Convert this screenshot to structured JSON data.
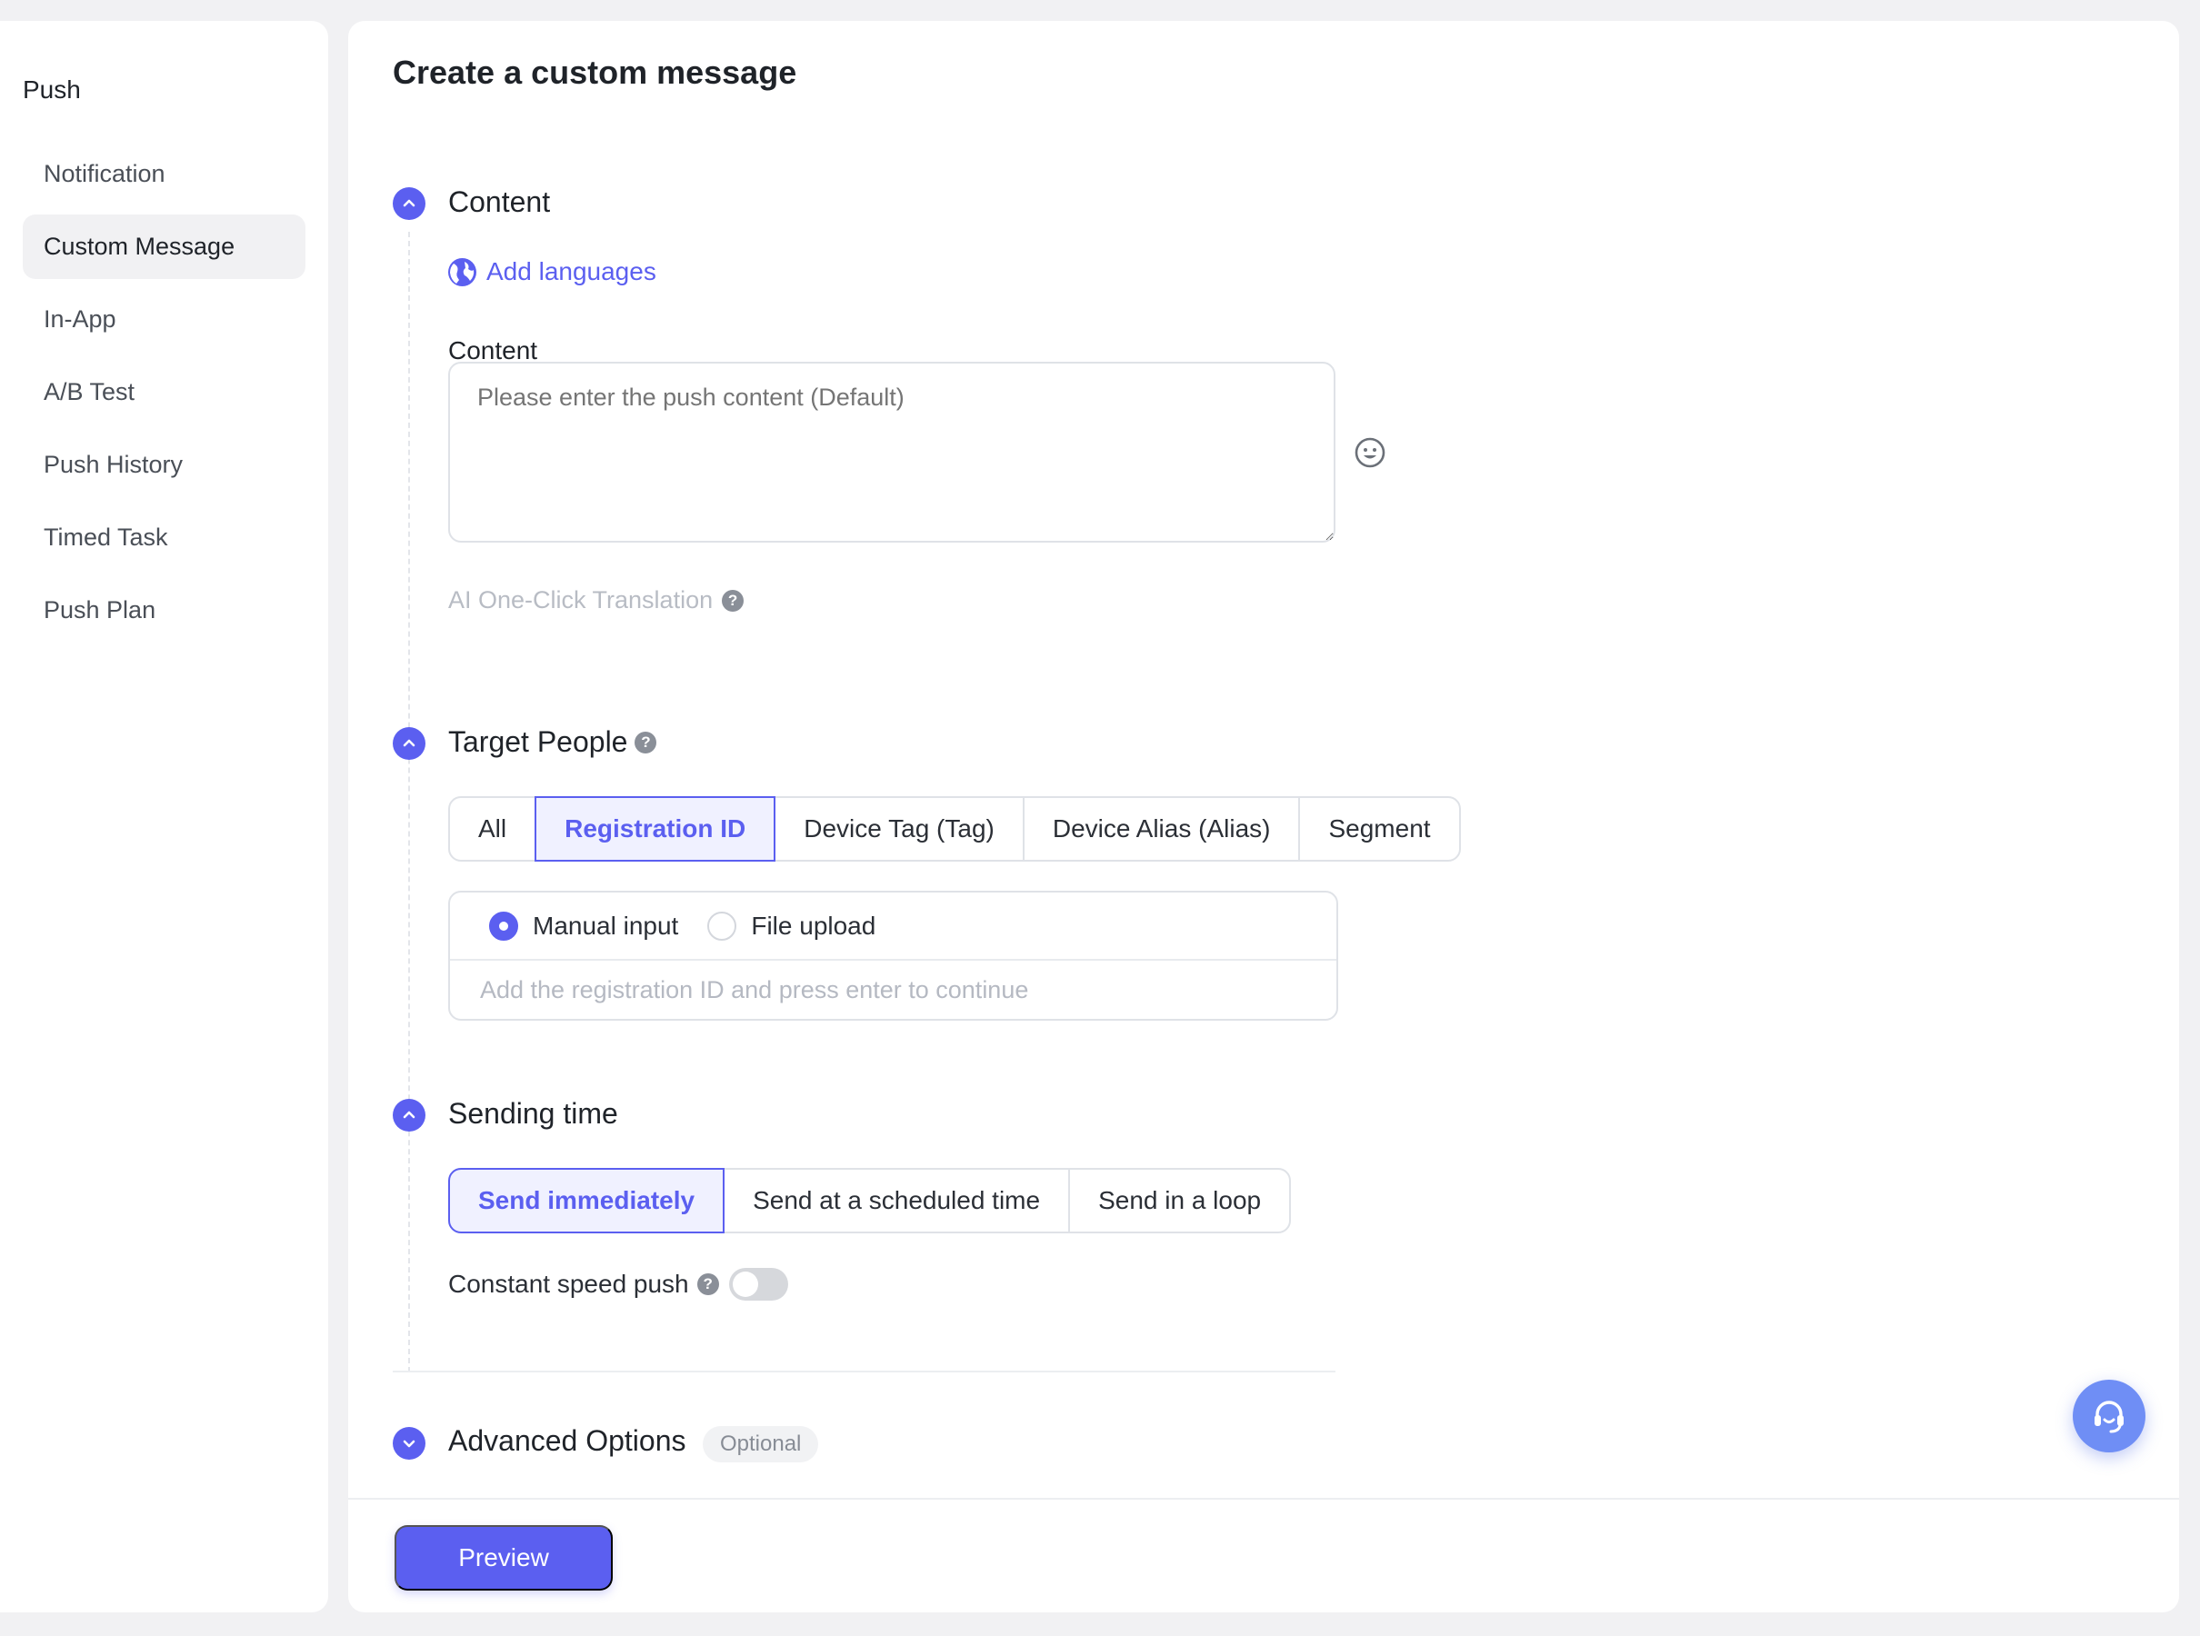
{
  "sidebar": {
    "title": "Push",
    "items": [
      {
        "label": "Notification"
      },
      {
        "label": "Custom Message"
      },
      {
        "label": "In-App"
      },
      {
        "label": "A/B Test"
      },
      {
        "label": "Push History"
      },
      {
        "label": "Timed Task"
      },
      {
        "label": "Push Plan"
      }
    ],
    "active_index": 1
  },
  "page": {
    "title": "Create a custom message"
  },
  "content_section": {
    "title": "Content",
    "add_languages": "Add languages",
    "field_label": "Content",
    "textarea_placeholder": "Please enter the push content (Default)",
    "textarea_value": "",
    "ai_translation": "AI One-Click Translation"
  },
  "target_section": {
    "title": "Target People",
    "tabs": [
      {
        "label": "All"
      },
      {
        "label": "Registration ID"
      },
      {
        "label": "Device Tag (Tag)"
      },
      {
        "label": "Device Alias (Alias)"
      },
      {
        "label": "Segment"
      }
    ],
    "active_tab": "Registration ID",
    "input_modes": [
      {
        "label": "Manual input",
        "selected": true
      },
      {
        "label": "File upload",
        "selected": false
      }
    ],
    "registration_placeholder": "Add the registration ID and press enter to continue"
  },
  "sending_section": {
    "title": "Sending time",
    "options": [
      {
        "label": "Send immediately"
      },
      {
        "label": "Send at a scheduled time"
      },
      {
        "label": "Send in a loop"
      }
    ],
    "active_option": "Send immediately",
    "constant_speed_label": "Constant speed push",
    "constant_speed_enabled": false
  },
  "advanced_section": {
    "title": "Advanced Options",
    "badge": "Optional"
  },
  "footer": {
    "preview_label": "Preview"
  },
  "icons": {
    "collapse": "chevron-up-icon",
    "expand": "chevron-down-icon",
    "language": "globe-icon",
    "emoji": "emoji-icon",
    "help": "help-icon",
    "support": "headset-icon"
  },
  "colors": {
    "accent": "#5b5ff0",
    "support_button": "#6f8ef5",
    "background": "#f1f1f3"
  }
}
